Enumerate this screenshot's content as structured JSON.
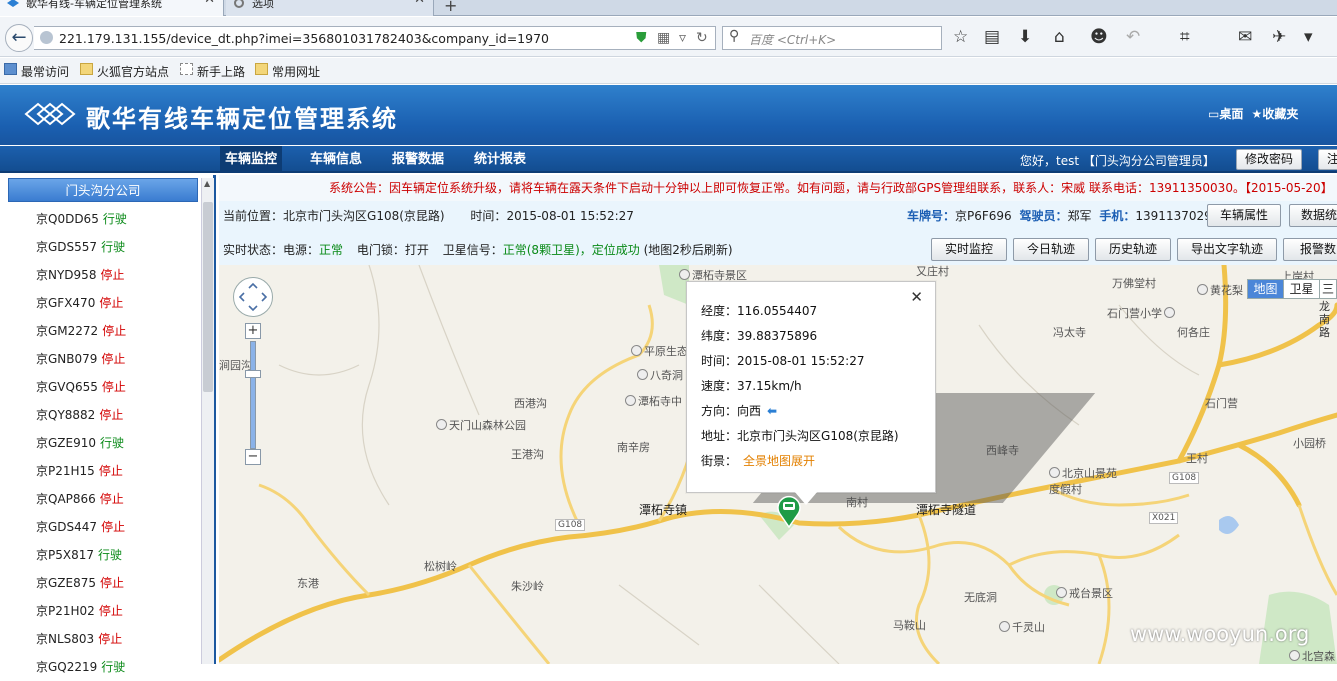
{
  "browser": {
    "tabs": [
      {
        "title": "歌华有线-车辆定位管理系统"
      },
      {
        "title": "选项"
      }
    ],
    "url": "221.179.131.155/device_dt.php?imei=356801031782403&company_id=1970",
    "search_placeholder": "百度 <Ctrl+K>",
    "bookmarks": [
      "最常访问",
      "火狐官方站点",
      "新手上路",
      "常用网址"
    ]
  },
  "header": {
    "title": "歌华有线车辆定位管理系统",
    "links": [
      "桌面",
      "收藏夹"
    ]
  },
  "nav": {
    "tabs": [
      "车辆监控",
      "车辆信息",
      "报警数据",
      "统计报表"
    ],
    "greeting": "您好，test 【门头沟分公司管理员】",
    "change_pwd": "修改密码",
    "logout": "注"
  },
  "sidebar": {
    "group": "门头沟分公司",
    "vehicles": [
      {
        "plate": "京Q0DD65",
        "status": "行驶"
      },
      {
        "plate": "京GDS557",
        "status": "行驶"
      },
      {
        "plate": "京NYD958",
        "status": "停止"
      },
      {
        "plate": "京GFX470",
        "status": "停止"
      },
      {
        "plate": "京GM2272",
        "status": "停止"
      },
      {
        "plate": "京GNB079",
        "status": "停止"
      },
      {
        "plate": "京GVQ655",
        "status": "停止"
      },
      {
        "plate": "京QY8882",
        "status": "停止"
      },
      {
        "plate": "京GZE910",
        "status": "行驶"
      },
      {
        "plate": "京P21H15",
        "status": "停止"
      },
      {
        "plate": "京QAP866",
        "status": "停止"
      },
      {
        "plate": "京GDS447",
        "status": "停止"
      },
      {
        "plate": "京P5X817",
        "status": "行驶"
      },
      {
        "plate": "京GZE875",
        "status": "停止"
      },
      {
        "plate": "京P21H02",
        "status": "停止"
      },
      {
        "plate": "京NLS803",
        "status": "停止"
      },
      {
        "plate": "京GQ2219",
        "status": "行驶"
      }
    ]
  },
  "notice": "系统公告：因车辆定位系统升级，请将车辆在露天条件下启动十分钟以上即可恢复正常。如有问题，请与行政部GPS管理组联系，联系人：宋威 联系电话：13911350030。【2015-05-20】",
  "info": {
    "position_label": "当前位置：",
    "position": "北京市门头沟区G108(京昆路)",
    "time_label": "时间：",
    "time": "2015-08-01 15:52:27",
    "plate_label": "车牌号：",
    "plate": "京P6F696",
    "driver_label": "驾驶员：",
    "driver": "郑军",
    "phone_label": "手机：",
    "phone": "13911370292",
    "btn_vehicle_attr": "车辆属性",
    "btn_data_stats": "数据统",
    "status_label": "实时状态：",
    "power_label": "电源：",
    "power": "正常",
    "door_label": "电门锁：",
    "door": "打开",
    "sat_label": "卫星信号：",
    "sat": "正常(8颗卫星)",
    "locate": "，定位成功",
    "refresh": "(地图2秒后刷新)",
    "buttons": [
      "实时监控",
      "今日轨迹",
      "历史轨迹",
      "导出文字轨迹",
      "报警数"
    ]
  },
  "map": {
    "types": [
      "地图",
      "卫星",
      "三"
    ],
    "labels": {
      "l1": "潭柘寺景区",
      "l2": "又庄村",
      "l3": "万佛堂村",
      "l4": "黄花梨",
      "l5": "上岸村",
      "l6": "石门营小学",
      "l7": "何各庄",
      "l8": "冯太寺",
      "l9": "平原生态",
      "l10": "八奇洞",
      "l11": "潭柘寺中",
      "l12": "西港沟",
      "l13": "天门山森林公园",
      "l14": "南辛房",
      "l15": "王港沟",
      "l16": "潭柘寺镇",
      "l17": "南村",
      "l18": "潭柘寺隧道",
      "l19": "西峰寺",
      "l20": "北京山景苑度假村",
      "l21": "王村",
      "l22": "石门营",
      "l23": "小园桥",
      "l24": "松树岭",
      "l25": "朱沙岭",
      "l26": "东港",
      "l27": "无底洞",
      "l28": "戒台景区",
      "l29": "马鞍山",
      "l30": "千灵山",
      "l31": "北宫森",
      "l32": "涧园沟",
      "l33": "石龙南路",
      "g108a": "G108",
      "g108b": "G108",
      "x021": "X021"
    },
    "popup": {
      "lng_label": "经度：",
      "lng": "116.0554407",
      "lat_label": "纬度：",
      "lat": "39.88375896",
      "time_label": "时间：",
      "time": "2015-08-01 15:52:27",
      "speed_label": "速度：",
      "speed": "37.15km/h",
      "dir_label": "方向：",
      "dir": "向西",
      "addr_label": "地址：",
      "addr": "北京市门头沟区G108(京昆路)",
      "street_label": "街景：",
      "street_link": "全景地图展开"
    },
    "watermark": "www.wooyun.org"
  }
}
